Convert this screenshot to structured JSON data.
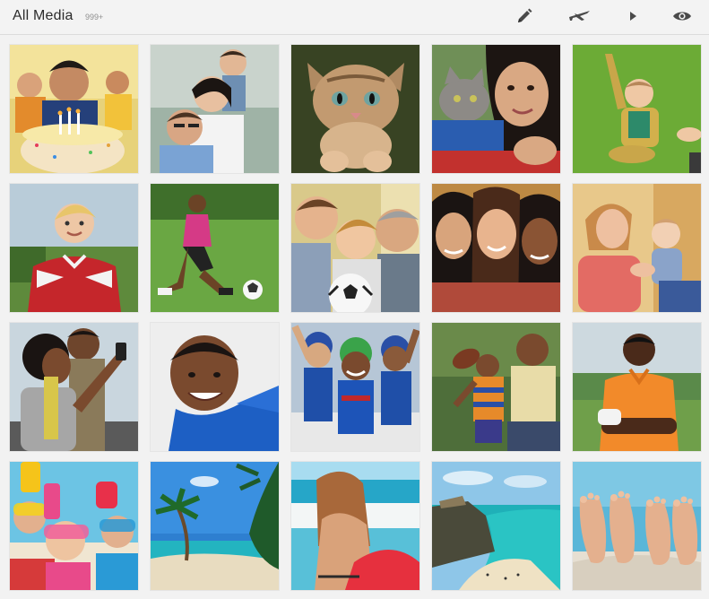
{
  "header": {
    "title": "All Media",
    "count": "999+"
  },
  "toolbar": [
    {
      "name": "edit",
      "icon": "pencil-icon"
    },
    {
      "name": "share",
      "icon": "airplane-icon"
    },
    {
      "name": "play",
      "icon": "play-icon"
    },
    {
      "name": "view",
      "icon": "eye-icon"
    }
  ],
  "colors": {
    "topbar": "#f3f3f3",
    "icon": "#4a4a4a",
    "background": "#f2f2f2"
  },
  "media": [
    {
      "id": "birthday-cake",
      "type": "photo"
    },
    {
      "id": "family-piggyback",
      "type": "photo"
    },
    {
      "id": "kitten",
      "type": "photo"
    },
    {
      "id": "girl-with-cat",
      "type": "photo"
    },
    {
      "id": "baby-on-grass",
      "type": "photo"
    },
    {
      "id": "boy-soccer-jersey",
      "type": "photo"
    },
    {
      "id": "girl-kicking-ball",
      "type": "photo"
    },
    {
      "id": "men-with-soccer-ball",
      "type": "photo"
    },
    {
      "id": "three-women-smiling",
      "type": "photo"
    },
    {
      "id": "mother-and-baby",
      "type": "photo"
    },
    {
      "id": "couple-selfie",
      "type": "photo"
    },
    {
      "id": "boy-blue-shirt",
      "type": "photo"
    },
    {
      "id": "kids-baseball-team",
      "type": "photo"
    },
    {
      "id": "grandfather-football",
      "type": "photo"
    },
    {
      "id": "man-orange-shirt",
      "type": "photo"
    },
    {
      "id": "kids-snorkeling",
      "type": "photo"
    },
    {
      "id": "palm-beach",
      "type": "photo"
    },
    {
      "id": "woman-bodyboard",
      "type": "photo"
    },
    {
      "id": "coastline-ruins",
      "type": "photo"
    },
    {
      "id": "feet-in-sand",
      "type": "photo"
    }
  ]
}
